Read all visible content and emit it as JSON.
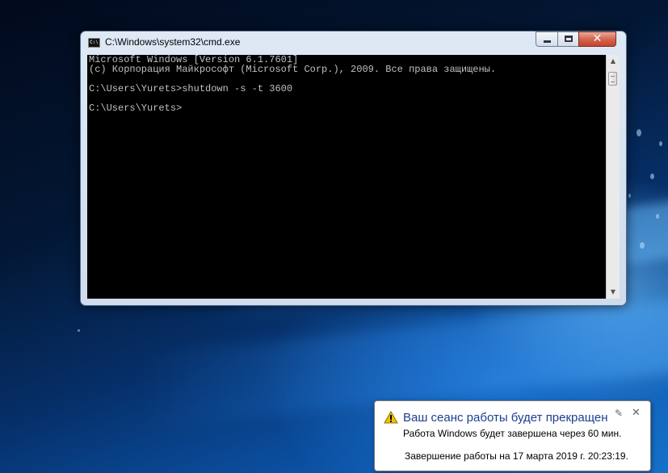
{
  "window": {
    "title": "C:\\Windows\\system32\\cmd.exe",
    "icon": "cmd-icon",
    "minimize_icon": "minimize-icon",
    "maximize_icon": "maximize-icon",
    "close_glyph": "✕"
  },
  "console": {
    "lines": [
      "Microsoft Windows [Version 6.1.7601]",
      "(c) Корпорация Майкрософт (Microsoft Corp.), 2009. Все права защищены.",
      "",
      "C:\\Users\\Yurets>shutdown -s -t 3600",
      "",
      "C:\\Users\\Yurets>"
    ],
    "text_color": "#c0c0c0",
    "background": "#000000"
  },
  "notification": {
    "title": "Ваш сеанс работы будет прекращен",
    "message": "Работа Windows будет завершена через 60 мин.",
    "detail": "Завершение работы на 17 марта 2019 г. 20:23:19.",
    "icon": "warning-icon",
    "close_glyph": "✕",
    "pin_glyph": "✎"
  }
}
